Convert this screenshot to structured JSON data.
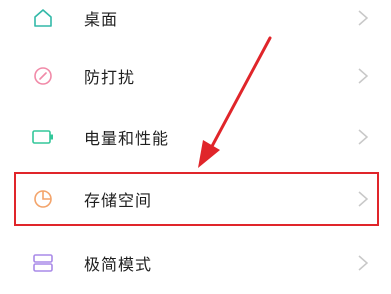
{
  "settings": {
    "items": [
      {
        "label": "桌面",
        "icon": "home-icon",
        "color": "#32b9a8"
      },
      {
        "label": "防打扰",
        "icon": "do-not-disturb-icon",
        "color": "#f18aa8"
      },
      {
        "label": "电量和性能",
        "icon": "battery-icon",
        "color": "#33c79a"
      },
      {
        "label": "存储空间",
        "icon": "storage-pie-icon",
        "color": "#f3a46b"
      },
      {
        "label": "极简模式",
        "icon": "simple-mode-icon",
        "color": "#a98ae8"
      }
    ]
  },
  "colors": {
    "highlight": "#e0252a",
    "chevron": "#c8c8c8"
  }
}
